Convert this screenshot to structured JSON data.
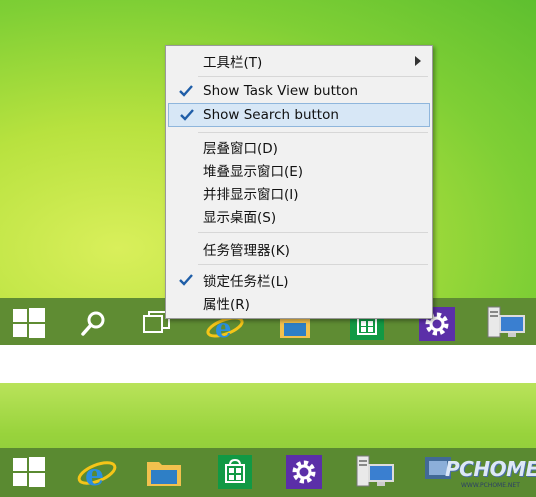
{
  "context_menu": {
    "items": [
      {
        "label": "工具栏(T)",
        "checked": false,
        "submenu": true
      },
      {
        "label": "Show Task View button",
        "checked": true
      },
      {
        "label": "Show Search button",
        "checked": true,
        "highlighted": true
      },
      {
        "label": "层叠窗口(D)"
      },
      {
        "label": "堆叠显示窗口(E)"
      },
      {
        "label": "并排显示窗口(I)"
      },
      {
        "label": "显示桌面(S)"
      },
      {
        "label": "任务管理器(K)"
      },
      {
        "label": "锁定任务栏(L)",
        "checked": true
      },
      {
        "label": "属性(R)"
      }
    ]
  },
  "taskbar_top": {
    "icons": [
      "windows-start-icon",
      "search-icon",
      "task-view-icon",
      "internet-explorer-icon",
      "file-explorer-icon",
      "store-icon",
      "settings-icon",
      "remote-desktop-icon"
    ]
  },
  "taskbar_bottom": {
    "icons": [
      "windows-start-icon",
      "internet-explorer-icon",
      "file-explorer-icon",
      "store-icon",
      "settings-icon",
      "remote-desktop-icon"
    ]
  },
  "watermark": {
    "logo_text": "PCHOME",
    "url": "WWW.PCHOME.NET"
  },
  "colors": {
    "menu_highlight": "#d7e7f6",
    "check_blue": "#1f5ea8",
    "taskbar_green": "#5f8c33",
    "settings_purple": "#5b2fa8",
    "store_green": "#119944"
  }
}
